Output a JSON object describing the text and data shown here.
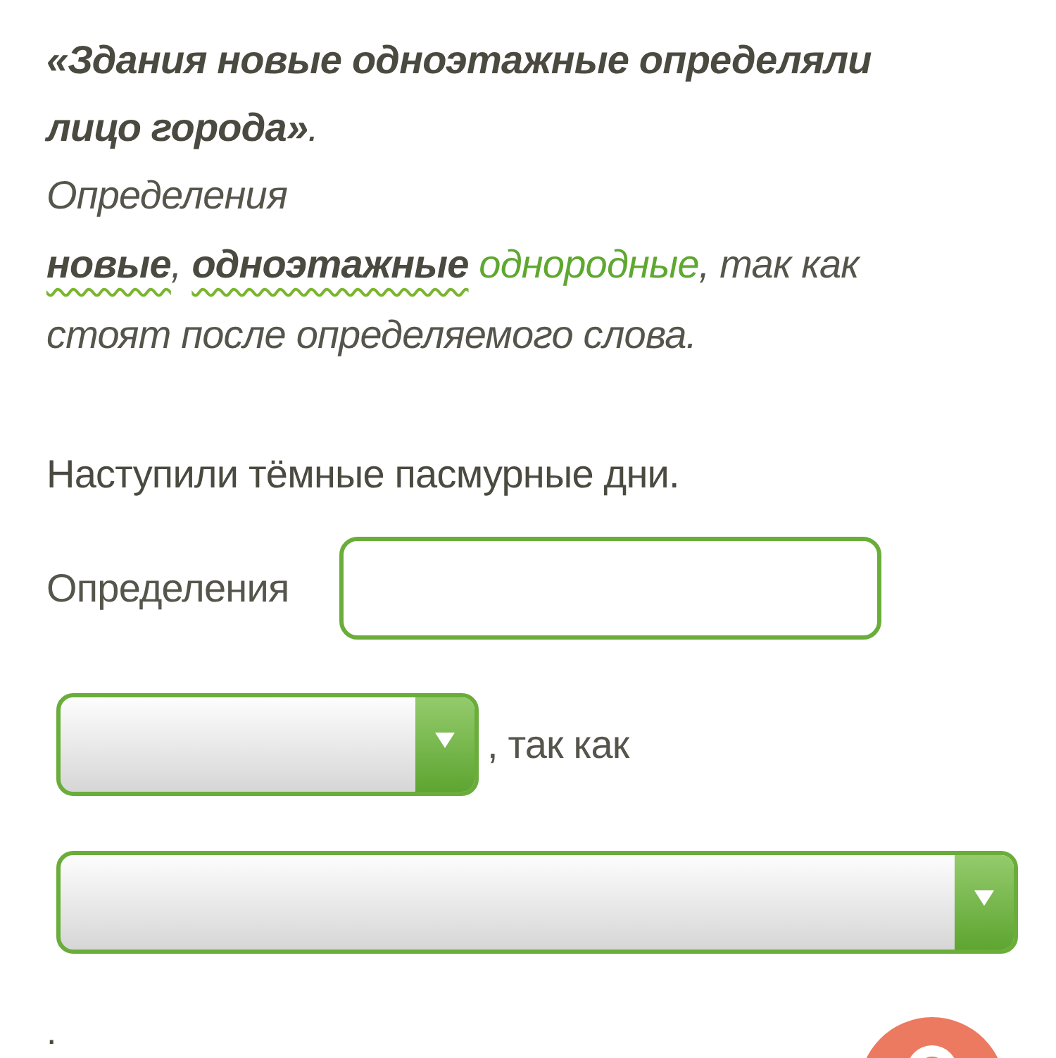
{
  "example": {
    "sentence": "**«Здания новые одноэтажные определяли лицо города»**.",
    "label": "Определения",
    "answer": "**новые**, **одноэтажные**",
    "choice": "однородные",
    "reason": ", так как стоят после определяемого слова."
  },
  "exercise": {
    "sentence": "Наступили тёмные пасмурные дни.",
    "definitions_label": "Определения",
    "connector": ", так как",
    "end_mark": "."
  }
}
